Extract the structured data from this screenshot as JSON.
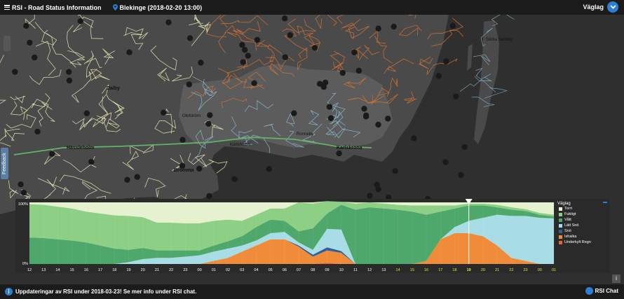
{
  "header": {
    "title": "RSI - Road Status Information",
    "location": "Blekinge (2018-02-20 13:00)",
    "layer": "Väglag"
  },
  "map": {
    "feedback_label": "Feedback",
    "places": [
      {
        "name": "Dalby",
        "id": "dalby"
      },
      {
        "name": "Olofström",
        "id": "olofstrom"
      },
      {
        "name": "Ronneby",
        "id": "ronneby"
      },
      {
        "name": "Karlshamn",
        "id": "karlshamn"
      },
      {
        "name": "Karlskrona",
        "id": "karlskrona"
      },
      {
        "name": "Hässleholm",
        "id": "hassleholm"
      },
      {
        "name": "Bromma",
        "id": "bromma"
      },
      {
        "name": "Södra Sandby",
        "id": "sodrasandby"
      }
    ]
  },
  "chart_data": {
    "type": "area",
    "ylim": [
      0,
      100
    ],
    "ytick_labels": [
      "100%",
      "0%"
    ],
    "x": [
      "12",
      "13",
      "14",
      "15",
      "16",
      "17",
      "18",
      "19",
      "20",
      "21",
      "22",
      "23",
      "00",
      "01",
      "02",
      "03",
      "04",
      "05",
      "06",
      "07",
      "08",
      "09",
      "10",
      "11",
      "12",
      "13",
      "14",
      "15",
      "16",
      "17",
      "18",
      "19",
      "20",
      "21",
      "22",
      "23",
      "00",
      "01"
    ],
    "highlighted_ticks": [
      "14",
      "15",
      "16",
      "17",
      "18",
      "19",
      "20",
      "21",
      "22",
      "23",
      "00",
      "01"
    ],
    "current_x": "19",
    "series": [
      {
        "name": "Underkylt Regn",
        "color": "#e8603c",
        "values": [
          0,
          0,
          0,
          0,
          0,
          0,
          0,
          0,
          0,
          0,
          0,
          0,
          0,
          0,
          0,
          0,
          0,
          0,
          0,
          0,
          0,
          2,
          0,
          0,
          0,
          0,
          0,
          0,
          0,
          0,
          0,
          0,
          0,
          0,
          0,
          0,
          0,
          0
        ]
      },
      {
        "name": "Ishalka",
        "color": "#f08b3a",
        "values": [
          0,
          0,
          0,
          0,
          0,
          0,
          0,
          0,
          0,
          0,
          0,
          0,
          0,
          5,
          10,
          20,
          30,
          40,
          40,
          28,
          12,
          20,
          18,
          0,
          0,
          0,
          0,
          0,
          5,
          40,
          50,
          50,
          45,
          30,
          10,
          5,
          0,
          0
        ]
      },
      {
        "name": "Snö",
        "color": "#2e5f9a",
        "values": [
          0,
          0,
          0,
          0,
          0,
          0,
          0,
          0,
          0,
          0,
          0,
          0,
          0,
          0,
          0,
          0,
          0,
          0,
          0,
          2,
          3,
          5,
          3,
          0,
          0,
          0,
          0,
          0,
          0,
          0,
          0,
          0,
          0,
          0,
          0,
          0,
          0,
          0
        ]
      },
      {
        "name": "Lätt Snö",
        "color": "#a8dde6",
        "values": [
          0,
          0,
          0,
          0,
          0,
          0,
          0,
          3,
          8,
          10,
          10,
          12,
          14,
          15,
          15,
          10,
          8,
          10,
          12,
          5,
          8,
          30,
          35,
          0,
          0,
          0,
          0,
          0,
          0,
          0,
          10,
          20,
          30,
          50,
          68,
          73,
          75,
          74
        ]
      },
      {
        "name": "Vått",
        "color": "#4ea86b",
        "values": [
          43,
          42,
          40,
          38,
          35,
          30,
          25,
          20,
          18,
          12,
          12,
          10,
          8,
          10,
          12,
          15,
          22,
          22,
          18,
          18,
          35,
          25,
          40,
          88,
          92,
          90,
          88,
          85,
          75,
          45,
          30,
          25,
          20,
          12,
          10,
          8,
          5,
          3
        ]
      },
      {
        "name": "Fuktigt",
        "color": "#8ccf85",
        "values": [
          54,
          54,
          53,
          52,
          50,
          52,
          54,
          55,
          50,
          45,
          45,
          44,
          44,
          40,
          35,
          25,
          20,
          18,
          20,
          47,
          40,
          20,
          5,
          10,
          8,
          8,
          8,
          10,
          15,
          10,
          5,
          3,
          3,
          4,
          4,
          3,
          3,
          3
        ]
      },
      {
        "name": "Torrt",
        "color": "#e6f2cf",
        "values": [
          3,
          4,
          7,
          10,
          15,
          18,
          21,
          22,
          24,
          33,
          33,
          34,
          34,
          30,
          28,
          30,
          20,
          10,
          10,
          0,
          2,
          0,
          0,
          2,
          0,
          2,
          4,
          5,
          5,
          5,
          5,
          2,
          2,
          4,
          8,
          11,
          17,
          20
        ]
      }
    ]
  },
  "legend": {
    "title": "Väglag",
    "items": [
      {
        "label": "Torrt",
        "color": "#e6f2cf"
      },
      {
        "label": "Fuktigt",
        "color": "#8ccf85"
      },
      {
        "label": "Vått",
        "color": "#4ea86b"
      },
      {
        "label": "Lätt Snö",
        "color": "#a8dde6"
      },
      {
        "label": "Snö",
        "color": "#2e5f9a"
      },
      {
        "label": "Ishalka",
        "color": "#f08b3a"
      },
      {
        "label": "Underkylt Regn",
        "color": "#e8603c"
      }
    ]
  },
  "footer": {
    "notice": "Uppdateringar av RSI under 2018-03-23! Se mer info under RSI chat.",
    "chat_label": "RSI Chat"
  },
  "colors": {
    "accent": "#2d7fd3",
    "road_orange": "#d9722f",
    "road_light": "#e9eab5",
    "road_blue": "#8fc7e0",
    "road_green": "#62b36a"
  }
}
